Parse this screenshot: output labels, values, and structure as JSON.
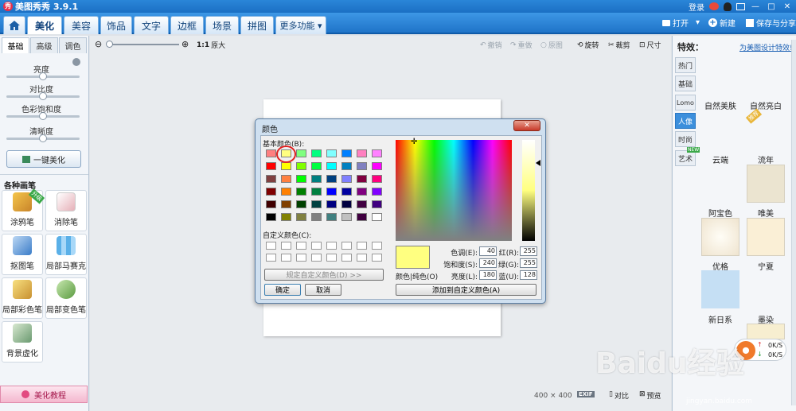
{
  "app": {
    "title": "美图秀秀 3.9.1",
    "logo_char": "秀"
  },
  "titlebar": {
    "login": "登录",
    "minimize": "—",
    "maximize": "□",
    "close": "✕"
  },
  "nav": {
    "tabs": [
      "美化",
      "美容",
      "饰品",
      "文字",
      "边框",
      "场景",
      "拼图",
      "更多功能 ▾"
    ],
    "active": "美化",
    "open_label": "打开",
    "new_label": "新建",
    "save_label": "保存与分享"
  },
  "left": {
    "tabs": [
      "基础",
      "高级",
      "调色"
    ],
    "sliders": [
      {
        "label": "亮度",
        "value": 0.5
      },
      {
        "label": "对比度",
        "value": 0.5
      },
      {
        "label": "色彩饱和度",
        "value": 0.5
      },
      {
        "label": "清晰度",
        "value": 0.5
      }
    ],
    "one_click": "一键美化",
    "brushes_title": "各种画笔",
    "tools": [
      {
        "label": "涂鸦笔",
        "badge": "升级"
      },
      {
        "label": "消除笔"
      },
      {
        "label": "抠图笔"
      },
      {
        "label": "局部马赛克"
      },
      {
        "label": "局部彩色笔"
      },
      {
        "label": "局部变色笔"
      },
      {
        "label": "背景虚化"
      }
    ],
    "tutorial": "美化教程"
  },
  "canvas_toolbar": {
    "zoom_one": "1:1",
    "zoom_label": "原大",
    "undo": "撤销",
    "redo": "重做",
    "original": "原图",
    "rotate": "旋转",
    "crop": "裁剪",
    "size": "尺寸"
  },
  "status": {
    "dims": "400 × 400",
    "exif": "EXIF",
    "compare": "对比",
    "preview": "预览"
  },
  "right": {
    "title": "特效：",
    "design_link": "为美图设计特效!",
    "tabs": [
      "热门",
      "基础",
      "Lomo",
      "人像",
      "时尚",
      "艺术"
    ],
    "active_tab": "人像",
    "new_badge": "NEW",
    "effects": [
      {
        "label": "自然美肤"
      },
      {
        "label": "自然亮白",
        "badge": "推荐"
      },
      {
        "label": "云端"
      },
      {
        "label": "流年"
      },
      {
        "label": "阿宝色"
      },
      {
        "label": "唯美"
      },
      {
        "label": "优格"
      },
      {
        "label": "宁夏"
      },
      {
        "label": "新日系"
      },
      {
        "label": "墨染"
      }
    ],
    "net_up": "0K/S",
    "net_down": "0K/S"
  },
  "dialog": {
    "title": "颜色",
    "basic_label": "基本颜色(B):",
    "custom_label": "自定义颜色(C):",
    "define_btn": "规定自定义颜色(D) >>",
    "ok": "确定",
    "cancel": "取消",
    "solid_label": "颜色|纯色(O)",
    "add_btn": "添加到自定义颜色(A)",
    "fields": [
      {
        "label": "色调(E):",
        "value": "40"
      },
      {
        "label": "饱和度(S):",
        "value": "240"
      },
      {
        "label": "亮度(L):",
        "value": "180"
      },
      {
        "label": "红(R):",
        "value": "255"
      },
      {
        "label": "绿(G):",
        "value": "255"
      },
      {
        "label": "蓝(U):",
        "value": "128"
      }
    ],
    "preview_color": "#ffff80",
    "basic_colors": [
      [
        "#ff8080",
        "#ffff80",
        "#80ff80",
        "#00ff80",
        "#80ffff",
        "#0080ff",
        "#ff80c0",
        "#ff80ff"
      ],
      [
        "#ff0000",
        "#ffff00",
        "#80ff00",
        "#00ff40",
        "#00ffff",
        "#0080c0",
        "#8080c0",
        "#ff00ff"
      ],
      [
        "#804040",
        "#ff8040",
        "#00ff00",
        "#008080",
        "#004080",
        "#8080ff",
        "#800040",
        "#ff0080"
      ],
      [
        "#800000",
        "#ff8000",
        "#008000",
        "#008040",
        "#0000ff",
        "#0000a0",
        "#800080",
        "#8000ff"
      ],
      [
        "#400000",
        "#804000",
        "#004000",
        "#004040",
        "#000080",
        "#000040",
        "#400040",
        "#400080"
      ],
      [
        "#000000",
        "#808000",
        "#808040",
        "#808080",
        "#408080",
        "#c0c0c0",
        "#400040",
        "#ffffff"
      ]
    ]
  },
  "watermark": "Baidu经验",
  "watermark_url": "jingyan.baidu.com"
}
